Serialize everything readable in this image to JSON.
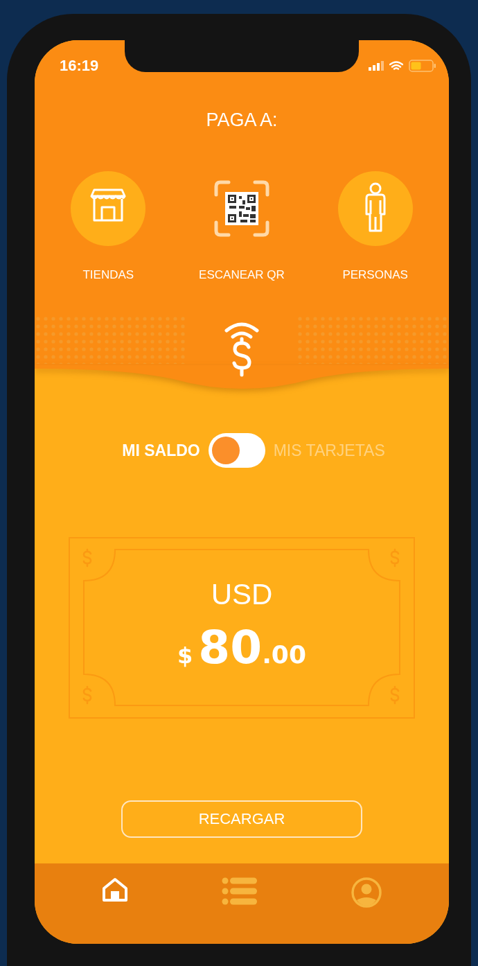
{
  "status_bar": {
    "time": "16:19"
  },
  "title": "PAGA A:",
  "pay_options": [
    {
      "kind": "store",
      "label": "TIENDAS"
    },
    {
      "kind": "qr",
      "label": "ESCANEAR QR"
    },
    {
      "kind": "person",
      "label": "PERSONAS"
    }
  ],
  "balance_toggle": {
    "left_label": "MI SALDO",
    "right_label": "MIS TARJETAS",
    "on": false
  },
  "balance": {
    "currency": "USD",
    "symbol": "$",
    "whole": "80",
    "decimals": ".00"
  },
  "recharge_button": "RECARGAR",
  "nav": [
    {
      "kind": "home",
      "selected": true
    },
    {
      "kind": "list",
      "selected": false
    },
    {
      "kind": "profile",
      "selected": false
    }
  ]
}
